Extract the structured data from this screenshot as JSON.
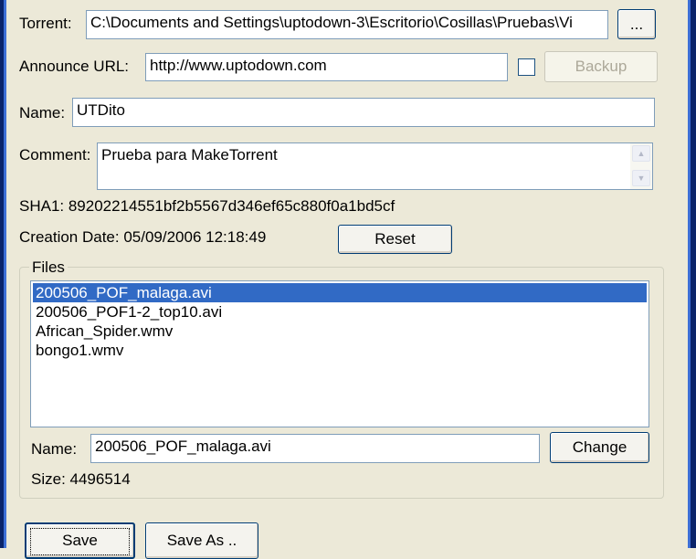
{
  "torrent": {
    "label": "Torrent:",
    "path": "C:\\Documents and Settings\\uptodown-3\\Escritorio\\Cosillas\\Pruebas\\Vi",
    "browse_label": "..."
  },
  "announce": {
    "label": "Announce URL:",
    "url": "http://www.uptodown.com",
    "backup_label": "Backup"
  },
  "name": {
    "label": "Name:",
    "value": "UTDito"
  },
  "comment": {
    "label": "Comment:",
    "value": "Prueba para MakeTorrent"
  },
  "sha1": {
    "text": "SHA1: 89202214551bf2b5567d346ef65c880f0a1bd5cf"
  },
  "creation": {
    "text": "Creation Date: 05/09/2006 12:18:49",
    "reset_label": "Reset"
  },
  "files": {
    "title": "Files",
    "items": [
      "200506_POF_malaga.avi",
      "200506_POF1-2_top10.avi",
      "African_Spider.wmv",
      "bongo1.wmv"
    ],
    "name_label": "Name:",
    "name_value": "200506_POF_malaga.avi",
    "change_label": "Change",
    "size_text": "Size: 4496514"
  },
  "actions": {
    "save_label": "Save",
    "save_as_label": "Save As .."
  }
}
